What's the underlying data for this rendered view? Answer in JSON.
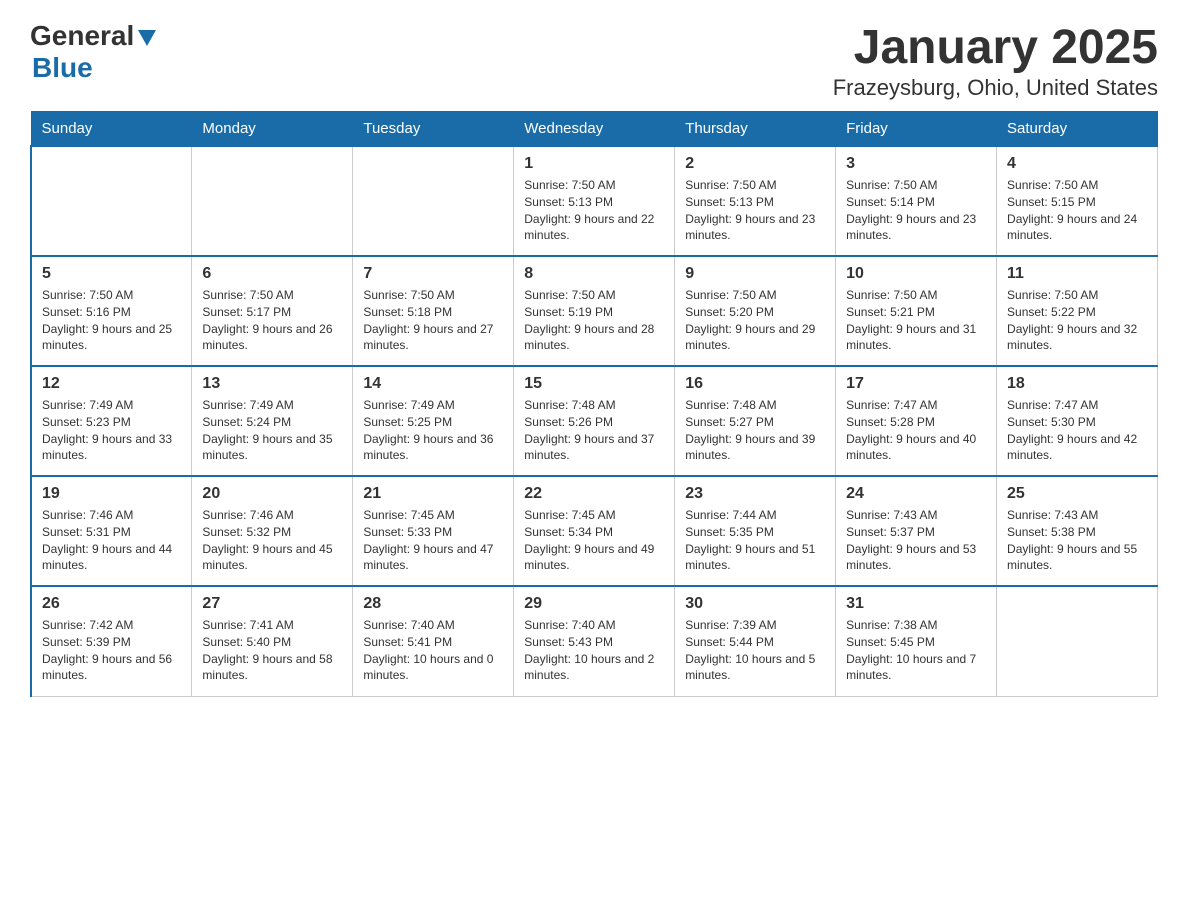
{
  "logo": {
    "general": "General",
    "blue": "Blue",
    "triangle": "▲"
  },
  "title": "January 2025",
  "subtitle": "Frazeysburg, Ohio, United States",
  "days_of_week": [
    "Sunday",
    "Monday",
    "Tuesday",
    "Wednesday",
    "Thursday",
    "Friday",
    "Saturday"
  ],
  "weeks": [
    [
      {
        "date": "",
        "sunrise": "",
        "sunset": "",
        "daylight": ""
      },
      {
        "date": "",
        "sunrise": "",
        "sunset": "",
        "daylight": ""
      },
      {
        "date": "",
        "sunrise": "",
        "sunset": "",
        "daylight": ""
      },
      {
        "date": "1",
        "sunrise": "Sunrise: 7:50 AM",
        "sunset": "Sunset: 5:13 PM",
        "daylight": "Daylight: 9 hours and 22 minutes."
      },
      {
        "date": "2",
        "sunrise": "Sunrise: 7:50 AM",
        "sunset": "Sunset: 5:13 PM",
        "daylight": "Daylight: 9 hours and 23 minutes."
      },
      {
        "date": "3",
        "sunrise": "Sunrise: 7:50 AM",
        "sunset": "Sunset: 5:14 PM",
        "daylight": "Daylight: 9 hours and 23 minutes."
      },
      {
        "date": "4",
        "sunrise": "Sunrise: 7:50 AM",
        "sunset": "Sunset: 5:15 PM",
        "daylight": "Daylight: 9 hours and 24 minutes."
      }
    ],
    [
      {
        "date": "5",
        "sunrise": "Sunrise: 7:50 AM",
        "sunset": "Sunset: 5:16 PM",
        "daylight": "Daylight: 9 hours and 25 minutes."
      },
      {
        "date": "6",
        "sunrise": "Sunrise: 7:50 AM",
        "sunset": "Sunset: 5:17 PM",
        "daylight": "Daylight: 9 hours and 26 minutes."
      },
      {
        "date": "7",
        "sunrise": "Sunrise: 7:50 AM",
        "sunset": "Sunset: 5:18 PM",
        "daylight": "Daylight: 9 hours and 27 minutes."
      },
      {
        "date": "8",
        "sunrise": "Sunrise: 7:50 AM",
        "sunset": "Sunset: 5:19 PM",
        "daylight": "Daylight: 9 hours and 28 minutes."
      },
      {
        "date": "9",
        "sunrise": "Sunrise: 7:50 AM",
        "sunset": "Sunset: 5:20 PM",
        "daylight": "Daylight: 9 hours and 29 minutes."
      },
      {
        "date": "10",
        "sunrise": "Sunrise: 7:50 AM",
        "sunset": "Sunset: 5:21 PM",
        "daylight": "Daylight: 9 hours and 31 minutes."
      },
      {
        "date": "11",
        "sunrise": "Sunrise: 7:50 AM",
        "sunset": "Sunset: 5:22 PM",
        "daylight": "Daylight: 9 hours and 32 minutes."
      }
    ],
    [
      {
        "date": "12",
        "sunrise": "Sunrise: 7:49 AM",
        "sunset": "Sunset: 5:23 PM",
        "daylight": "Daylight: 9 hours and 33 minutes."
      },
      {
        "date": "13",
        "sunrise": "Sunrise: 7:49 AM",
        "sunset": "Sunset: 5:24 PM",
        "daylight": "Daylight: 9 hours and 35 minutes."
      },
      {
        "date": "14",
        "sunrise": "Sunrise: 7:49 AM",
        "sunset": "Sunset: 5:25 PM",
        "daylight": "Daylight: 9 hours and 36 minutes."
      },
      {
        "date": "15",
        "sunrise": "Sunrise: 7:48 AM",
        "sunset": "Sunset: 5:26 PM",
        "daylight": "Daylight: 9 hours and 37 minutes."
      },
      {
        "date": "16",
        "sunrise": "Sunrise: 7:48 AM",
        "sunset": "Sunset: 5:27 PM",
        "daylight": "Daylight: 9 hours and 39 minutes."
      },
      {
        "date": "17",
        "sunrise": "Sunrise: 7:47 AM",
        "sunset": "Sunset: 5:28 PM",
        "daylight": "Daylight: 9 hours and 40 minutes."
      },
      {
        "date": "18",
        "sunrise": "Sunrise: 7:47 AM",
        "sunset": "Sunset: 5:30 PM",
        "daylight": "Daylight: 9 hours and 42 minutes."
      }
    ],
    [
      {
        "date": "19",
        "sunrise": "Sunrise: 7:46 AM",
        "sunset": "Sunset: 5:31 PM",
        "daylight": "Daylight: 9 hours and 44 minutes."
      },
      {
        "date": "20",
        "sunrise": "Sunrise: 7:46 AM",
        "sunset": "Sunset: 5:32 PM",
        "daylight": "Daylight: 9 hours and 45 minutes."
      },
      {
        "date": "21",
        "sunrise": "Sunrise: 7:45 AM",
        "sunset": "Sunset: 5:33 PM",
        "daylight": "Daylight: 9 hours and 47 minutes."
      },
      {
        "date": "22",
        "sunrise": "Sunrise: 7:45 AM",
        "sunset": "Sunset: 5:34 PM",
        "daylight": "Daylight: 9 hours and 49 minutes."
      },
      {
        "date": "23",
        "sunrise": "Sunrise: 7:44 AM",
        "sunset": "Sunset: 5:35 PM",
        "daylight": "Daylight: 9 hours and 51 minutes."
      },
      {
        "date": "24",
        "sunrise": "Sunrise: 7:43 AM",
        "sunset": "Sunset: 5:37 PM",
        "daylight": "Daylight: 9 hours and 53 minutes."
      },
      {
        "date": "25",
        "sunrise": "Sunrise: 7:43 AM",
        "sunset": "Sunset: 5:38 PM",
        "daylight": "Daylight: 9 hours and 55 minutes."
      }
    ],
    [
      {
        "date": "26",
        "sunrise": "Sunrise: 7:42 AM",
        "sunset": "Sunset: 5:39 PM",
        "daylight": "Daylight: 9 hours and 56 minutes."
      },
      {
        "date": "27",
        "sunrise": "Sunrise: 7:41 AM",
        "sunset": "Sunset: 5:40 PM",
        "daylight": "Daylight: 9 hours and 58 minutes."
      },
      {
        "date": "28",
        "sunrise": "Sunrise: 7:40 AM",
        "sunset": "Sunset: 5:41 PM",
        "daylight": "Daylight: 10 hours and 0 minutes."
      },
      {
        "date": "29",
        "sunrise": "Sunrise: 7:40 AM",
        "sunset": "Sunset: 5:43 PM",
        "daylight": "Daylight: 10 hours and 2 minutes."
      },
      {
        "date": "30",
        "sunrise": "Sunrise: 7:39 AM",
        "sunset": "Sunset: 5:44 PM",
        "daylight": "Daylight: 10 hours and 5 minutes."
      },
      {
        "date": "31",
        "sunrise": "Sunrise: 7:38 AM",
        "sunset": "Sunset: 5:45 PM",
        "daylight": "Daylight: 10 hours and 7 minutes."
      },
      {
        "date": "",
        "sunrise": "",
        "sunset": "",
        "daylight": ""
      }
    ]
  ]
}
